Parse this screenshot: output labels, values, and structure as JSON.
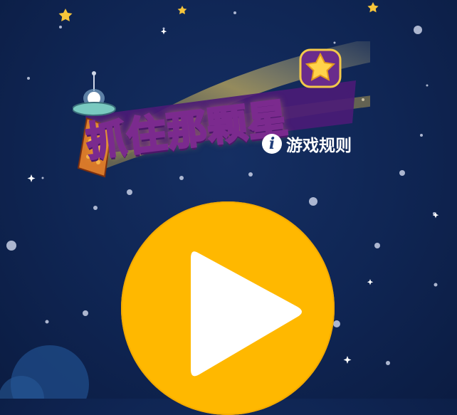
{
  "game": {
    "title": "抓住那颗星",
    "rules_label": "游戏规则",
    "rules_icon": "info-icon",
    "play_icon": "play-icon"
  },
  "colors": {
    "background": "#0f2553",
    "play_button": "#ffb800",
    "title_fill": "#f7e37a",
    "title_outline": "#7b2a8e",
    "star": "#ffd34a"
  }
}
